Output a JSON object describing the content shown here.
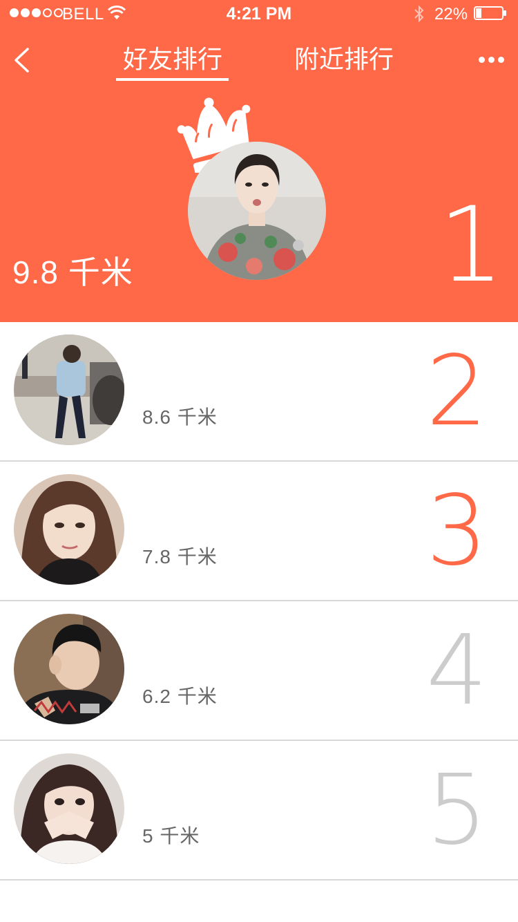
{
  "status_bar": {
    "carrier": "BELL",
    "time": "4:21 PM",
    "battery_percent": "22%",
    "signal_bars_filled": 3,
    "signal_bars_total": 5,
    "battery_level": 0.22
  },
  "nav": {
    "back_icon": "chevron-left-icon",
    "tabs": [
      {
        "label": "好友排行",
        "active": true
      },
      {
        "label": "附近排行",
        "active": false
      }
    ],
    "more_icon": "more-dots-icon"
  },
  "top_rank": {
    "rank": "1",
    "distance": "9.8 千米",
    "crown_icon": "crown-icon"
  },
  "list": [
    {
      "rank": "2",
      "distance": "8.6 千米",
      "rank_color": "#ff6948"
    },
    {
      "rank": "3",
      "distance": "7.8 千米",
      "rank_color": "#ff6948"
    },
    {
      "rank": "4",
      "distance": "6.2 千米",
      "rank_color": "#cccccc"
    },
    {
      "rank": "5",
      "distance": "5 千米",
      "rank_color": "#cccccc"
    }
  ],
  "colors": {
    "accent": "#ff6948",
    "divider": "#d8d8d8",
    "muted_rank": "#cccccc",
    "text_secondary": "#666666"
  }
}
